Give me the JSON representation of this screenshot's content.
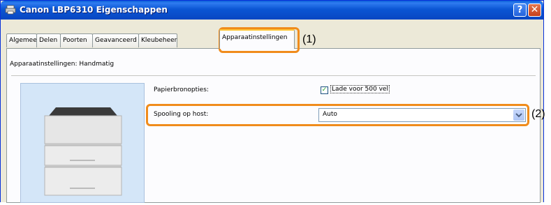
{
  "window": {
    "title": "Canon LBP6310 Eigenschappen",
    "help_label": "?",
    "close_label": "✕"
  },
  "tabs": [
    {
      "label": "Algemeen"
    },
    {
      "label": "Delen"
    },
    {
      "label": "Poorten"
    },
    {
      "label": "Geavanceerd"
    },
    {
      "label": "Kleubeheer"
    },
    {
      "label": "Apparaatinstellingen",
      "active": true
    }
  ],
  "panel": {
    "title": "Apparaatinstellingen: Handmatig",
    "paper_source_label": "Papierbronopties:",
    "paper_source_checkbox_label": "Lade voor 500 vel",
    "paper_source_checked": true,
    "spooling_label": "Spooling op host:",
    "spooling_value": "Auto"
  },
  "callouts": {
    "tab_callout": "(1)",
    "spooling_callout": "(2)"
  },
  "colors": {
    "titlebar": "#0846c2",
    "highlight": "#f08c1c",
    "dialog_bg": "#ece9d8",
    "preview_bg": "#d4e6f8"
  }
}
